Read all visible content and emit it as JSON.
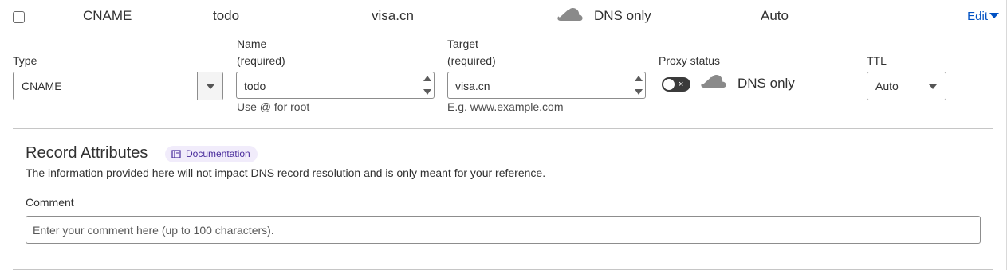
{
  "summary": {
    "type": "CNAME",
    "name": "todo",
    "target": "visa.cn",
    "proxy_status": "DNS only",
    "ttl": "Auto",
    "edit_label": "Edit",
    "cloud_icon": "cloud-icon"
  },
  "form": {
    "type": {
      "label": "Type",
      "value": "CNAME"
    },
    "name": {
      "label_line1": "Name",
      "label_line2": "(required)",
      "value": "todo",
      "help": "Use @ for root"
    },
    "target": {
      "label_line1": "Target",
      "label_line2": "(required)",
      "value": "visa.cn",
      "help": "E.g. www.example.com"
    },
    "proxy": {
      "label": "Proxy status",
      "toggle_on": false,
      "toggle_mark": "×",
      "text": "DNS only"
    },
    "ttl": {
      "label": "TTL",
      "value": "Auto"
    }
  },
  "attributes": {
    "title": "Record Attributes",
    "doc_badge": "Documentation",
    "description": "The information provided here will not impact DNS record resolution and is only meant for your reference.",
    "comment_label": "Comment",
    "comment_placeholder": "Enter your comment here (up to 100 characters)."
  },
  "colors": {
    "link": "#0051c3",
    "badge_bg": "#f1ecfb",
    "badge_text": "#4a2d9c",
    "toggle_off": "#3b3b3b",
    "cloud_grey": "#8a8a8a"
  }
}
